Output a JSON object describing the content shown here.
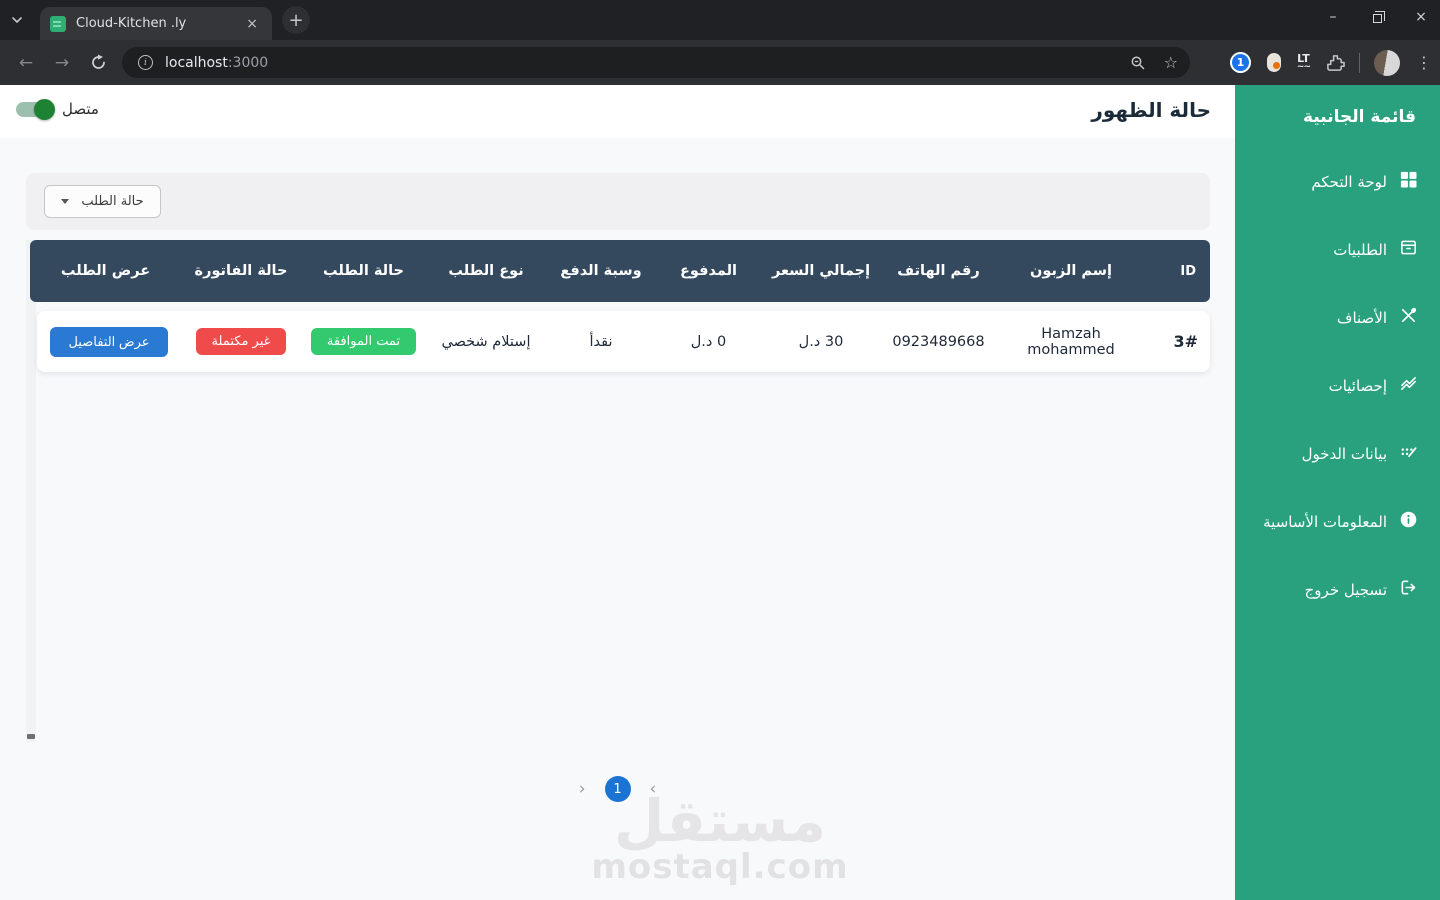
{
  "browser": {
    "tab_title": "Cloud-Kitchen .ly",
    "url_host": "localhost",
    "url_port": ":3000"
  },
  "icons": {
    "close_tab": "×",
    "new_tab": "+",
    "minimize": "–",
    "close_window": "×",
    "back": "←",
    "forward": "→",
    "star": "☆",
    "kebab": "⋮",
    "info": "i",
    "onepassword": "1",
    "lt_ext": "LT",
    "lt_ext_wave": "~~",
    "chevron_next": "›",
    "chevron_prev": "‹"
  },
  "sidebar": {
    "title": "قائمة الجانبية",
    "items": [
      {
        "label": "لوحة التحكم",
        "icon": "dashboard-icon"
      },
      {
        "label": "الطلبيات",
        "icon": "orders-icon"
      },
      {
        "label": "الأصناف",
        "icon": "categories-icon"
      },
      {
        "label": "إحصائيات",
        "icon": "statistics-icon"
      },
      {
        "label": "بيانات الدخول",
        "icon": "credentials-icon"
      },
      {
        "label": "المعلومات الأساسية",
        "icon": "info-icon"
      },
      {
        "label": "تسجيل خروج",
        "icon": "logout-icon"
      }
    ]
  },
  "header": {
    "title": "حالة الظهور",
    "toggle_label": "متصل",
    "toggle_state": "on"
  },
  "filter": {
    "status_dropdown_label": "حالة الطلب"
  },
  "table": {
    "columns": [
      "ID",
      "إسم الزبون",
      "رقم الهاتف",
      "إجمالي السعر",
      "المدفوع",
      "وسبة الدفع",
      "نوع الطلب",
      "حالة الطلب",
      "حالة الفاتورة",
      "عرض الطلب"
    ],
    "rows": [
      {
        "id": "3#",
        "customer": "Hamzah mohammed",
        "phone": "0923489668",
        "total": "30 د.ل",
        "paid": "0 د.ل",
        "payment_method": "نقدأ",
        "order_type": "إستلام شخصي",
        "order_status": "تمت الموافقة",
        "invoice_status": "غير مكتملة",
        "view_details_label": "عرض التفاصيل"
      }
    ]
  },
  "pagination": {
    "current_page": "1"
  },
  "watermark": {
    "logo": "مستقل",
    "domain": "mostaql.com"
  },
  "colors": {
    "sidebar_green": "#2aa17e",
    "table_header": "#35495e",
    "details_button_blue": "#2a7ad4",
    "status_green": "#33c96e",
    "status_red": "#f04b4b",
    "pagination_blue": "#1b74d3",
    "toggle_green": "#1e8234",
    "favicon_green": "#2fad72"
  }
}
